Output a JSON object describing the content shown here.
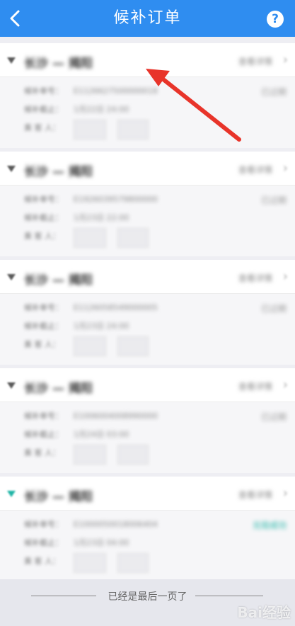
{
  "header": {
    "title": "候补订单",
    "back_icon": "chevron-left-icon",
    "help_icon": "question-icon",
    "help_glyph": "?"
  },
  "orders": [
    {
      "route": "长沙 — 揭阳",
      "detail_link": "查看详情",
      "order_label": "候补单号：",
      "order_value": "E1126627500000018",
      "deadline_label": "候补截止：",
      "deadline_value": "1月22日 24:00",
      "passenger_label": "乘 客 人：",
      "status": "已过期",
      "accent": "#5a5a5a"
    },
    {
      "route": "长沙 — 揭阳",
      "detail_link": "查看详情",
      "order_label": "候补单号：",
      "order_value": "E1926039579800000",
      "deadline_label": "候补截止：",
      "deadline_value": "1月23日 22:00",
      "passenger_label": "乘 客 人：",
      "status": "已过期",
      "accent": "#5a5a5a"
    },
    {
      "route": "长沙 — 揭阳",
      "detail_link": "查看详情",
      "order_label": "候补单号：",
      "order_value": "E1126058549000005",
      "deadline_label": "候补截止：",
      "deadline_value": "1月23日 24:00",
      "passenger_label": "乘 客 人：",
      "status": "已过期",
      "accent": "#5a5a5a"
    },
    {
      "route": "长沙 — 揭阳",
      "detail_link": "查看详情",
      "order_label": "候补单号：",
      "order_value": "E1006004008990000",
      "deadline_label": "候补截止：",
      "deadline_value": "1月24日 03:00",
      "passenger_label": "乘 客 人：",
      "status": "已过期",
      "accent": "#5a5a5a"
    },
    {
      "route": "长沙 — 揭阳",
      "detail_link": "查看详情",
      "order_label": "候补单号：",
      "order_value": "E1000050018006404",
      "deadline_label": "候补截止：",
      "deadline_value": "1月23日 04:00",
      "passenger_label": "乘 客 人：",
      "status": "兑现成功",
      "accent": "#1fb5a6"
    }
  ],
  "footer": {
    "end_text": "已经是最后一页了"
  },
  "watermark": {
    "text": "Bai经验"
  }
}
